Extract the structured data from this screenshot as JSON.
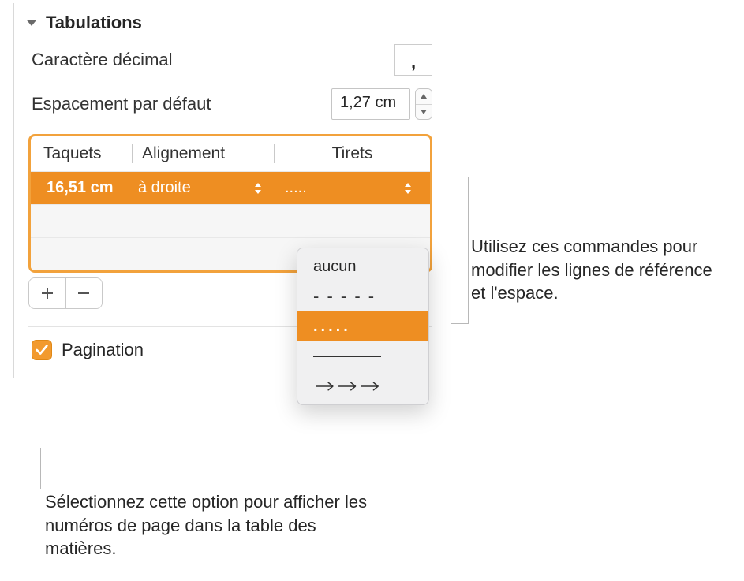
{
  "section": {
    "title": "Tabulations"
  },
  "decimal": {
    "label": "Caractère décimal",
    "value": ","
  },
  "spacing": {
    "label": "Espacement par défaut",
    "value": "1,27 cm"
  },
  "table": {
    "headers": {
      "stops": "Taquets",
      "alignment": "Alignement",
      "leaders": "Tirets"
    },
    "row": {
      "stop": "16,51 cm",
      "alignment": "à droite",
      "leader": "....."
    }
  },
  "dropdown": {
    "none": "aucun",
    "dashes": "- - - - -",
    "dots": ".....",
    "line": "———",
    "arrows": "→→→"
  },
  "pagination": {
    "label": "Pagination"
  },
  "callouts": {
    "right": "Utilisez ces commandes pour modifier les lignes de référence et l'espace.",
    "bottom": "Sélectionnez cette option pour afficher les numéros de page dans la table des matières."
  }
}
